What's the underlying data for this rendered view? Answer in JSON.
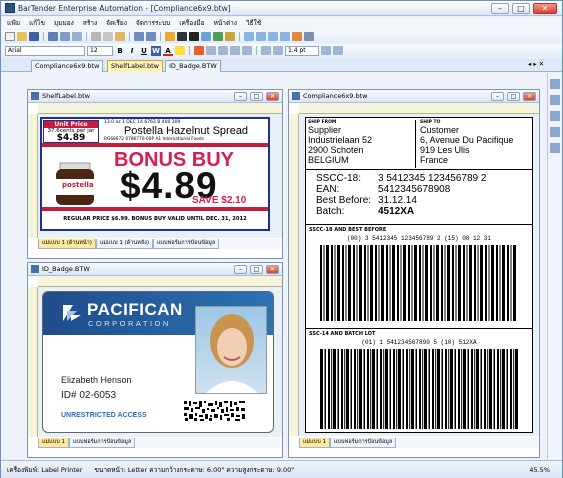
{
  "app": {
    "title": "BarTender Enterprise Automation - [Compliance6x9.btw]"
  },
  "menu": [
    "แฟ้ม",
    "แก้ไข",
    "มุมมอง",
    "สร้าง",
    "จัดเรียง",
    "จัดการระบบ",
    "เครื่องมือ",
    "หน้าต่าง",
    "วิธีใช้"
  ],
  "format": {
    "font": "Arial",
    "size": "12",
    "line_width": "1.4 pt"
  },
  "tabs": [
    "Compliance6x9.btw",
    "ShelfLabel.btw",
    "ID_Badge.BTW"
  ],
  "tab_controls": "◂ ▸ ✕",
  "windows": {
    "shelf": {
      "title": "ShelfLabel.btw",
      "tabs": [
        "แม่แบบ 1 (ด้านหน้า)",
        "แม่แบบ 1 (ด้านหลัง)",
        "แบบฟอร์มการป้อนข้อมูล"
      ]
    },
    "badge": {
      "title": "ID_Badge.BTW",
      "tabs": [
        "แม่แบบ 1",
        "แบบฟอร์มการป้อนข้อมูล"
      ]
    },
    "compliance": {
      "title": "Compliance6x9.btw",
      "tabs": [
        "แม่แบบ 1",
        "แบบฟอร์มการป้อนข้อมูล"
      ]
    }
  },
  "shelf_label": {
    "unit_price_label": "Unit Price",
    "unit_price_detail": "37.6cents per jar",
    "unit_price": "$4.89",
    "product_meta": "13.0 oz   1 DEC 14   6763 B   400 309",
    "product_name": "Postella Hazelnut Spread",
    "product_codes": "RG68672   6786770-00P   A1 International Foods",
    "jar_brand": "postella",
    "bonus_buy": "BONUS BUY",
    "price": "$4.89",
    "save": "SAVE $2.10",
    "regular": "REGULAR PRICE $6.99.  BONUS BUY VALID UNTIL DEC. 31, 2012"
  },
  "badge": {
    "company": "PACIFICAN",
    "company_sub": "CORPORATION",
    "name": "Elizabeth Henson",
    "id": "ID# 02-6053",
    "access": "UNRESTRICTED ACCESS"
  },
  "compliance": {
    "ship_from_label": "SHIP FROM",
    "ship_from": [
      "Supplier",
      "Industrielaan 52",
      "2900 Schoten",
      "BELGIUM"
    ],
    "ship_to_label": "SHIP TO",
    "ship_to": [
      "Customer",
      "6, Avenue Du Pacifique",
      "919 Les Ulis",
      "France"
    ],
    "sscc_label": "SSCC-18:",
    "sscc": "3 5412345 123456789 2",
    "ean_label": "EAN:",
    "ean": "5412345678908",
    "best_label": "Best Before:",
    "best": "31.12.14",
    "batch_label": "Batch:",
    "batch": "4512XA",
    "section1": "SSCC-18 AND BEST BEFORE",
    "hr1": "(00) 3 5412345 123456789 2 (15) 08 12 31",
    "section2": "SSC-14 AND BATCH LOT",
    "hr2": "(01) 1 541234567890 5 (10) 512XA"
  },
  "status": {
    "printer": "เครื่องพิมพ์: Label Printer",
    "size": "ขนาดหน้า: Letter  ความกว้างกระดาษ: 6.00\"  ความสูงกระดาษ: 9.00\"",
    "zoom": "45.5%"
  }
}
